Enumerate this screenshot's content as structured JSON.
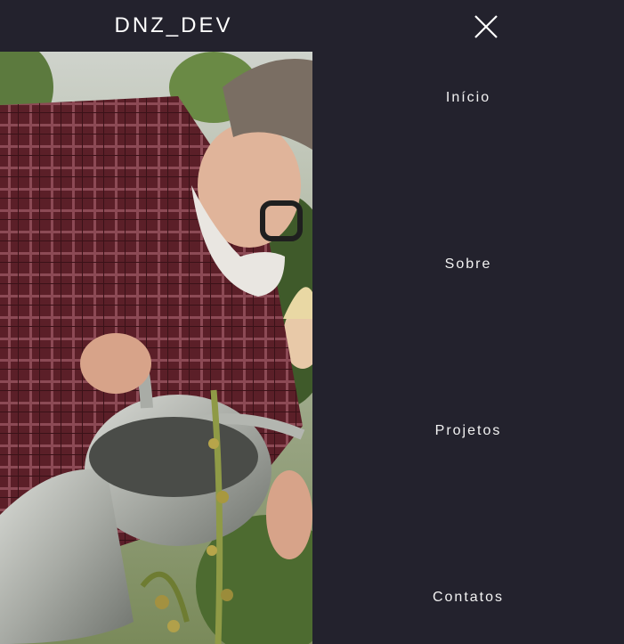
{
  "header": {
    "brand": "DNZ_DEV",
    "close_icon": "close-icon"
  },
  "photo": {
    "description_icon": "photo-elderly-man-watering-can"
  },
  "nav": {
    "items": [
      {
        "label": "Início"
      },
      {
        "label": "Sobre"
      },
      {
        "label": "Projetos"
      },
      {
        "label": "Contatos"
      }
    ]
  },
  "colors": {
    "background": "#23222d",
    "text": "#f2f2f2"
  }
}
